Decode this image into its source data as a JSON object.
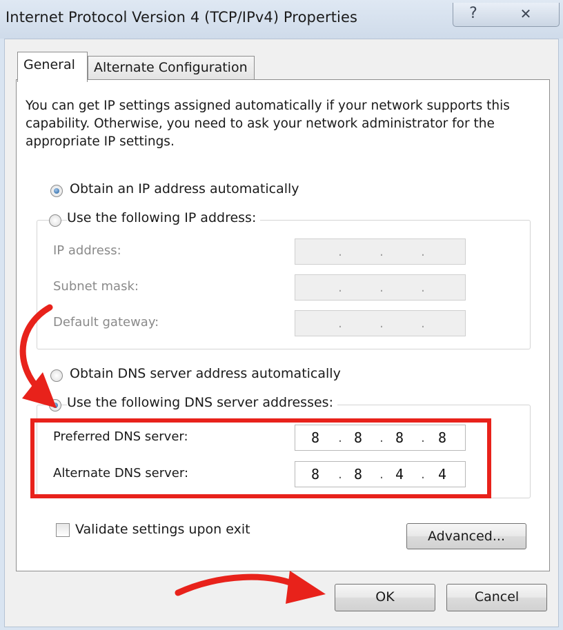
{
  "window": {
    "title": "Internet Protocol Version 4 (TCP/IPv4) Properties",
    "help_glyph": "?",
    "close_glyph": "✕"
  },
  "tabs": [
    {
      "label": "General",
      "active": true
    },
    {
      "label": "Alternate Configuration",
      "active": false
    }
  ],
  "general": {
    "intro": "You can get IP settings assigned automatically if your network supports this capability. Otherwise, you need to ask your network administrator for the appropriate IP settings.",
    "ip_mode": {
      "auto_label": "Obtain an IP address automatically",
      "manual_label": "Use the following IP address:",
      "selected": "auto"
    },
    "ip_fields": [
      {
        "label": "IP address:",
        "octets": [
          "",
          "",
          "",
          ""
        ]
      },
      {
        "label": "Subnet mask:",
        "octets": [
          "",
          "",
          "",
          ""
        ]
      },
      {
        "label": "Default gateway:",
        "octets": [
          "",
          "",
          "",
          ""
        ]
      }
    ],
    "dns_mode": {
      "auto_label": "Obtain DNS server address automatically",
      "manual_label": "Use the following DNS server addresses:",
      "selected": "manual"
    },
    "dns_fields": [
      {
        "label": "Preferred DNS server:",
        "octets": [
          "8",
          "8",
          "8",
          "8"
        ]
      },
      {
        "label": "Alternate DNS server:",
        "octets": [
          "8",
          "8",
          "4",
          "4"
        ]
      }
    ],
    "validate_label": "Validate settings upon exit",
    "validate_checked": false,
    "advanced_label": "Advanced..."
  },
  "footer": {
    "ok_label": "OK",
    "cancel_label": "Cancel"
  },
  "annotation_color": "#e8221b"
}
